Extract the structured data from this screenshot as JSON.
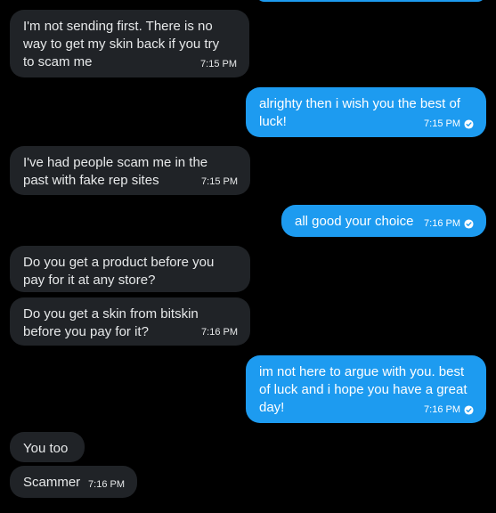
{
  "colors": {
    "background": "#000000",
    "incoming_bubble": "#202327",
    "outgoing_bubble": "#1d9bf0",
    "text": "#e7e9ea"
  },
  "messages": [
    {
      "direction": "incoming",
      "text": "I'm not sending first. There is no\nway to get my skin back if you try\nto scam me",
      "time": "7:15 PM"
    },
    {
      "direction": "outgoing",
      "text": "alrighty then i wish you the best of\nluck!",
      "time": "7:15 PM",
      "status_icon": "check-circle-icon"
    },
    {
      "direction": "incoming",
      "text": "I've had people scam me in the\npast with fake rep sites",
      "time": "7:15 PM"
    },
    {
      "direction": "outgoing",
      "text": "all good your choice",
      "time": "7:16 PM",
      "status_icon": "check-circle-icon"
    },
    {
      "direction": "incoming",
      "text": "Do you get a product before you\npay for it at any store?",
      "time": ""
    },
    {
      "direction": "incoming",
      "text": "Do you get a skin from bitskin\nbefore you pay for it?",
      "time": "7:16 PM"
    },
    {
      "direction": "outgoing",
      "text": "im not here to argue with you. best\nof luck and i hope you have a great\nday!",
      "time": "7:16 PM",
      "status_icon": "check-circle-icon"
    },
    {
      "direction": "incoming",
      "text": "You too",
      "time": ""
    },
    {
      "direction": "incoming",
      "text": "Scammer",
      "time": "7:16 PM"
    }
  ]
}
